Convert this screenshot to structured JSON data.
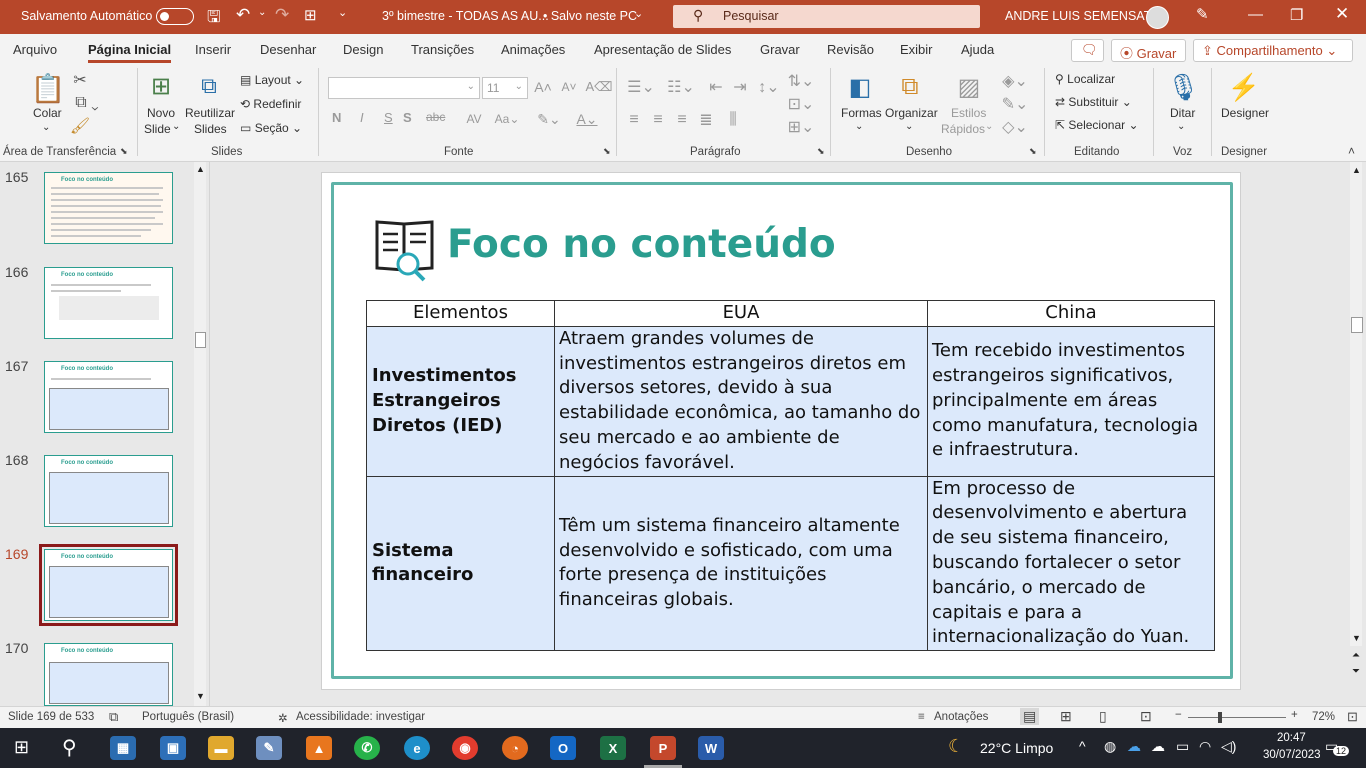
{
  "titlebar": {
    "autosave_label": "Salvamento Automático",
    "doc_title": "3º bimestre - TODAS AS AU...",
    "save_status": "• Salvo neste PC",
    "search_placeholder": "Pesquisar",
    "user_name": "ANDRE LUIS SEMENSATO"
  },
  "menu": {
    "tabs": [
      "Arquivo",
      "Página Inicial",
      "Inserir",
      "Desenhar",
      "Design",
      "Transições",
      "Animações",
      "Apresentação de Slides",
      "Gravar",
      "Revisão",
      "Exibir",
      "Ajuda"
    ],
    "record_button": "Gravar",
    "share_button": "Compartilhamento"
  },
  "ribbon": {
    "clipboard": {
      "paste": "Colar",
      "group": "Área de Transferência"
    },
    "slides": {
      "new_slide_1": "Novo",
      "new_slide_2": "Slide",
      "reuse_1": "Reutilizar",
      "reuse_2": "Slides",
      "layout": "Layout",
      "reset": "Redefinir",
      "section": "Seção",
      "group": "Slides"
    },
    "font": {
      "size": "11",
      "bold": "N",
      "italic": "I",
      "underline": "S",
      "strike": "abc",
      "group": "Fonte"
    },
    "paragraph": {
      "group": "Parágrafo"
    },
    "drawing": {
      "shapes": "Formas",
      "arrange": "Organizar",
      "styles_1": "Estilos",
      "styles_2": "Rápidos",
      "group": "Desenho"
    },
    "editing": {
      "find": "Localizar",
      "replace": "Substituir",
      "select": "Selecionar",
      "group": "Editando"
    },
    "voice": {
      "dictate": "Ditar",
      "group": "Voz"
    },
    "designer": {
      "label": "Designer",
      "group": "Designer"
    }
  },
  "thumbnails": [
    {
      "num": "165",
      "title": "Foco no conteúdo"
    },
    {
      "num": "166",
      "title": "Foco no conteúdo"
    },
    {
      "num": "167",
      "title": "Foco no conteúdo"
    },
    {
      "num": "168",
      "title": "Foco no conteúdo"
    },
    {
      "num": "169",
      "title": "Foco no conteúdo"
    },
    {
      "num": "170",
      "title": "Foco no conteúdo"
    }
  ],
  "slide": {
    "title": "Foco no conteúdo",
    "table": {
      "headers": [
        "Elementos",
        "EUA",
        "China"
      ],
      "rows": [
        {
          "element": "Investimentos Estrangeiros Diretos (IED)",
          "eua": "Atraem grandes volumes de investimentos estrangeiros diretos em diversos setores, devido à sua estabilidade econômica, ao tamanho do seu mercado e ao ambiente de negócios favorável.",
          "china": "Tem recebido investimentos estrangeiros significativos, principalmente em áreas como manufatura, tecnologia e infraestrutura."
        },
        {
          "element": "Sistema financeiro",
          "eua": "Têm um sistema financeiro altamente desenvolvido e sofisticado, com uma forte presença de instituições financeiras globais.",
          "china": "Em processo de desenvolvimento e abertura de seu sistema financeiro, buscando fortalecer o setor bancário, o mercado de capitais e para a internacionalização do Yuan."
        }
      ]
    }
  },
  "status": {
    "slide_count": "Slide 169 de 533",
    "language": "Português (Brasil)",
    "accessibility": "Acessibilidade: investigar",
    "notes": "Anotações",
    "zoom": "72%"
  },
  "taskbar": {
    "weather": "22°C  Limpo",
    "time": "20:47",
    "date": "30/07/2023",
    "notifications": "12"
  },
  "colors": {
    "accent": "#b7472a",
    "teal": "#2a9d8f",
    "cell": "#dce9fb",
    "header_red": "#c00000"
  }
}
